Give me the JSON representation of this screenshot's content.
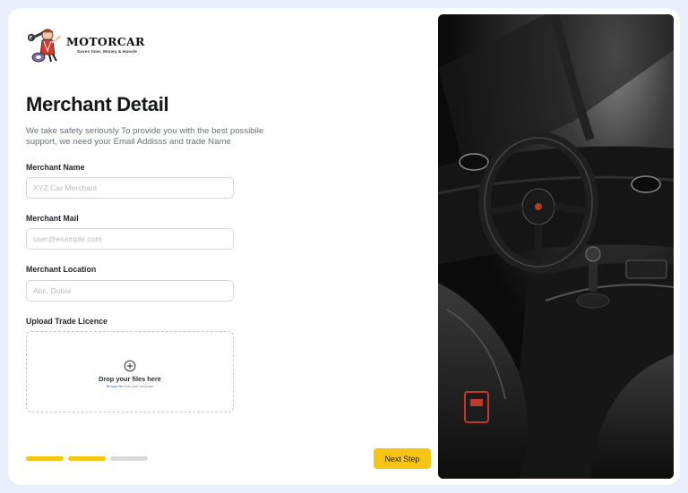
{
  "brand": {
    "name": "MOTORCAR",
    "tagline": "Saves time, Money & Hassle"
  },
  "page": {
    "title": "Merchant Detail",
    "subtitle": "We take safety seriously To provide you with the best possibile support, we need your Email Addisss and trade Name"
  },
  "form": {
    "merchant_name": {
      "label": "Merchant Name",
      "placeholder": "XYZ Car Merchant",
      "value": ""
    },
    "merchant_mail": {
      "label": "Merchant Mail",
      "placeholder": "user@example.com",
      "value": ""
    },
    "merchant_location": {
      "label": "Merchant Location",
      "placeholder": "Abc, Dubai",
      "value": ""
    },
    "upload": {
      "label": "Upload Trade Licence",
      "title": "Drop your files here",
      "browse_link": "Browse file",
      "browse_suffix": " from your computer",
      "icon": "plus-circle-icon"
    }
  },
  "progress": {
    "total_steps": 3,
    "completed_steps": 2
  },
  "actions": {
    "next_label": "Next Step"
  },
  "colors": {
    "accent": "#f7c513",
    "progress_done": "#f7c513",
    "progress_pending": "#d9d9d9",
    "page_background": "#e8eefb",
    "link": "#2f6fd6"
  }
}
